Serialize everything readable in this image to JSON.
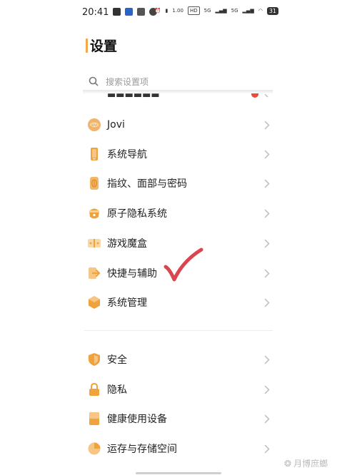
{
  "status_bar": {
    "time": "20:41",
    "speed": "1.00",
    "net_labels": [
      "5G",
      "5G"
    ],
    "battery": "31"
  },
  "page": {
    "title": "设置",
    "search_placeholder": "搜索设置项"
  },
  "group1": [
    {
      "label": "Jovi",
      "icon": "jovi-icon"
    },
    {
      "label": "系统导航",
      "icon": "phone-navigation-icon"
    },
    {
      "label": "指纹、面部与密码",
      "icon": "fingerprint-icon"
    },
    {
      "label": "原子隐私系统",
      "icon": "atom-privacy-icon"
    },
    {
      "label": "游戏魔盒",
      "icon": "game-box-icon"
    },
    {
      "label": "快捷与辅助",
      "icon": "shortcut-assist-icon"
    },
    {
      "label": "系统管理",
      "icon": "system-management-icon"
    }
  ],
  "group2": [
    {
      "label": "安全",
      "icon": "shield-icon"
    },
    {
      "label": "隐私",
      "icon": "lock-icon"
    },
    {
      "label": "健康使用设备",
      "icon": "health-device-icon"
    },
    {
      "label": "运存与存储空间",
      "icon": "storage-pie-icon"
    }
  ],
  "watermark": "月博庶螂",
  "colors": {
    "accent": "#f2a74a",
    "icon_orange": "#f0a23c",
    "check_red": "#d9464f",
    "badge_red": "#e74c3c"
  }
}
